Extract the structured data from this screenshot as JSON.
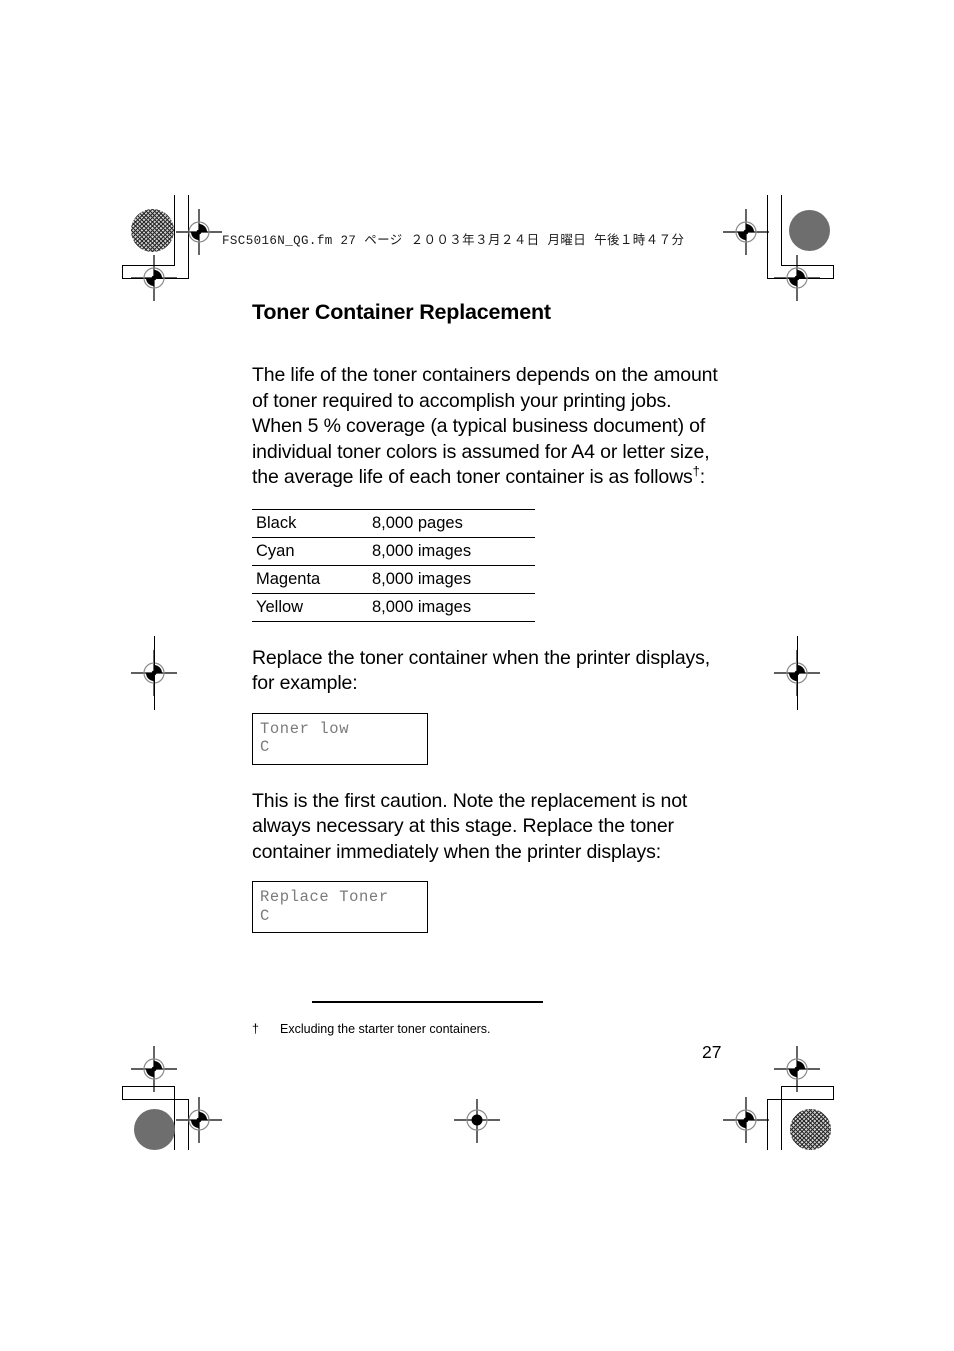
{
  "document": {
    "header_slug": "FSC5016N_QG.fm  27 ページ  ２００３年３月２４日  月曜日  午後１時４７分",
    "page_number": "27"
  },
  "section": {
    "title": "Toner Container Replacement",
    "intro_paragraph": "The life of the toner containers depends on the amount of toner required to accomplish your printing jobs. When 5 % coverage (a typical business document) of individual toner colors is assumed for A4 or letter size, the average life of each toner container is as follows",
    "intro_footnote_marker": "†",
    "intro_paragraph_end": ":",
    "paragraph_2": "Replace the toner container when the printer displays, for example:",
    "paragraph_3": "This is the first caution. Note the replacement is not always necessary at this stage. Replace the toner container immediately when the printer displays:"
  },
  "toner_table": {
    "rows": [
      {
        "color": "Black",
        "life": "8,000 pages"
      },
      {
        "color": "Cyan",
        "life": "8,000 images"
      },
      {
        "color": "Magenta",
        "life": "8,000 images"
      },
      {
        "color": "Yellow",
        "life": "8,000 images"
      }
    ]
  },
  "displays": [
    {
      "line1": "Toner low",
      "line2": "C"
    },
    {
      "line1": "Replace Toner",
      "line2": "C"
    }
  ],
  "footnote": {
    "marker": "†",
    "text": "Excluding the starter toner containers."
  },
  "colors": {
    "text": "#000000",
    "lcd_text": "#7b7b7b",
    "registration_solid": "#6e6e6e"
  }
}
